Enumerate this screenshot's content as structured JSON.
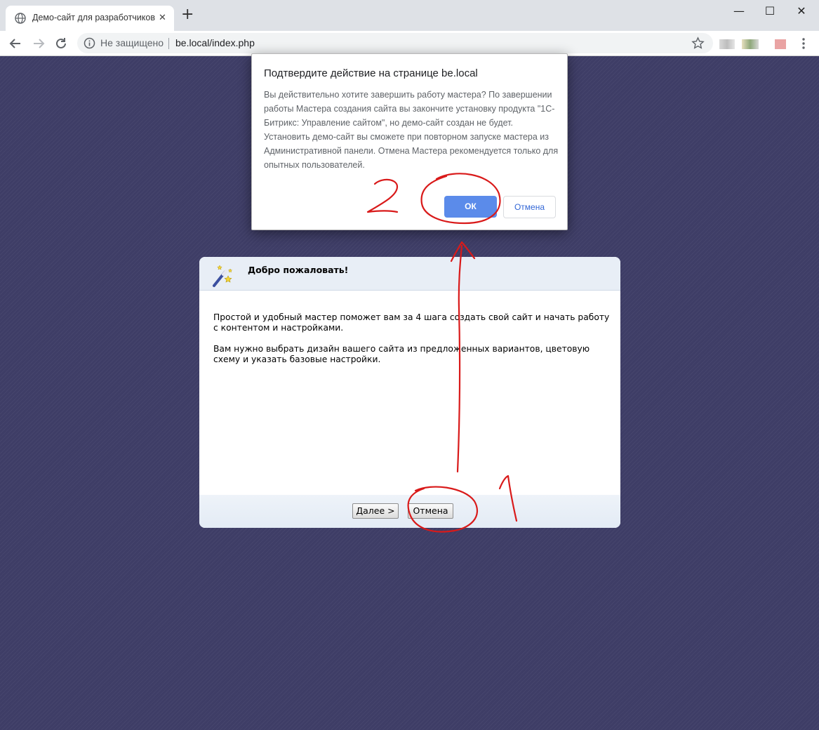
{
  "browser": {
    "tab_title": "Демо-сайт для разработчиков",
    "tab_close": "✕",
    "new_tab": "+",
    "window_controls": {
      "minimize": "—",
      "maximize": "☐",
      "close": "✕"
    },
    "security_label": "Не защищено",
    "url": "be.local/index.php"
  },
  "dialog": {
    "title": "Подтвердите действие на странице be.local",
    "message": "Вы действительно хотите завершить работу мастера? По завершении работы Мастера создания сайта вы закончите установку продукта \"1С-Битрикс: Управление сайтом\", но демо-сайт создан не будет. Установить демо-сайт вы сможете при повторном запуске мастера из Административной панели. Отмена Мастера рекомендуется только для опытных пользователей.",
    "ok_label": "ОК",
    "cancel_label": "Отмена"
  },
  "wizard": {
    "title": "Добро пожаловать!",
    "paragraphs": [
      "Простой и удобный мастер поможет вам за 4 шага создать свой сайт и начать работу с контентом и настройками.",
      "Вам нужно выбрать дизайн вашего сайта из предложенных вариантов, цветовую схему и указать базовые настройки."
    ],
    "next_label": "Далее >",
    "cancel_label": "Отмена"
  },
  "annotation": {
    "color": "#d91a1a",
    "step1": "1",
    "step2": "2"
  },
  "colors": {
    "page_background": "#3e3d66",
    "dialog_ok": "#5b8bea",
    "link_blue": "#3367d6"
  }
}
